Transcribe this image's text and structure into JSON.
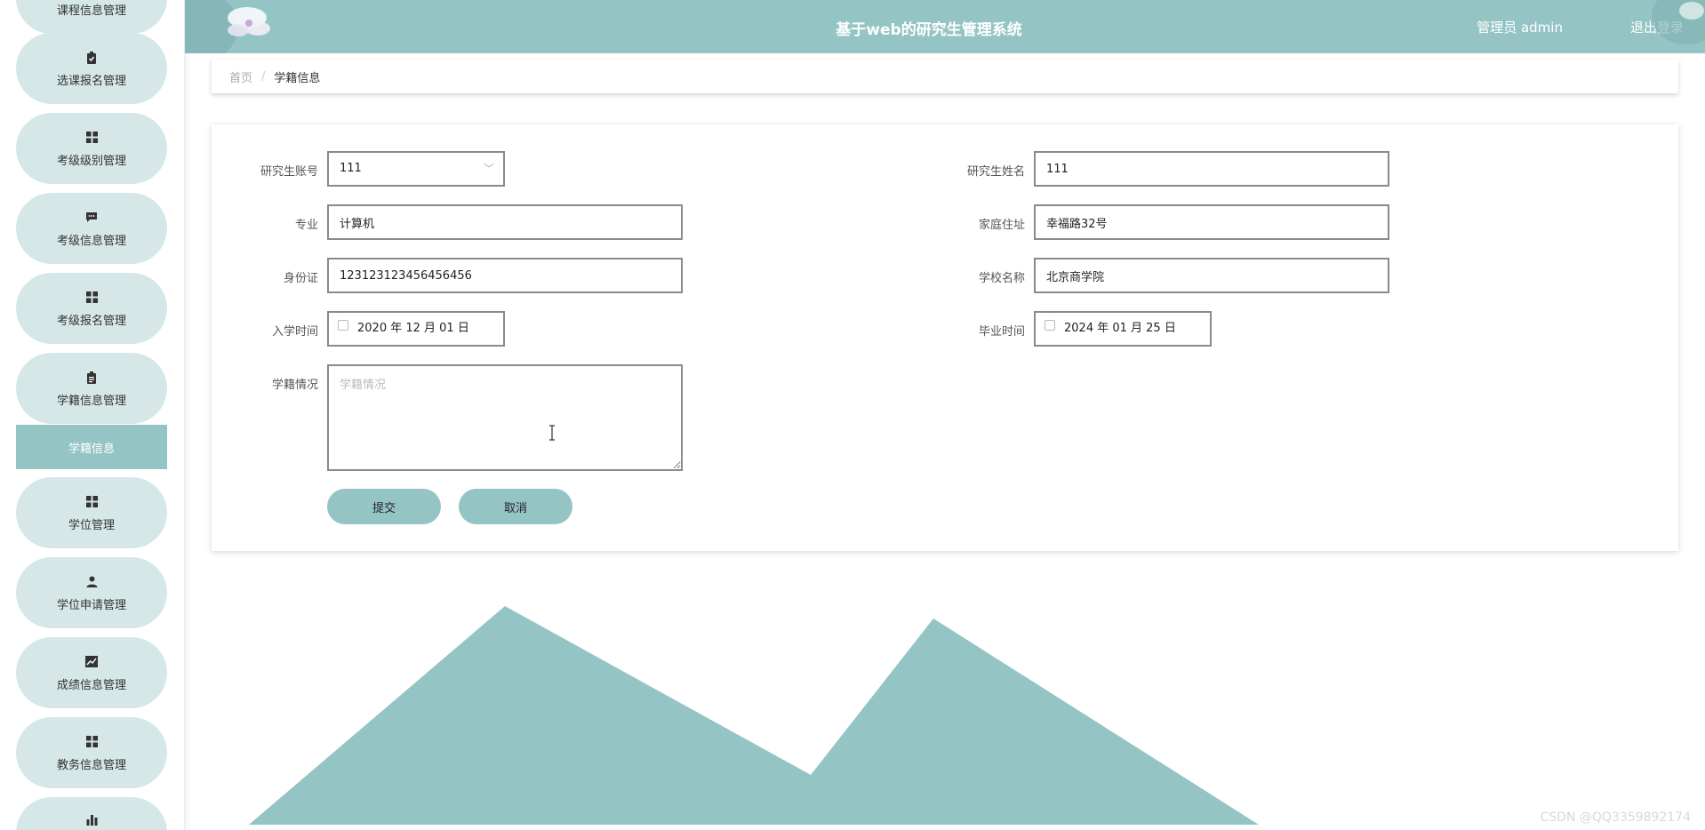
{
  "header": {
    "title": "基于web的研究生管理系统",
    "user": "管理员 admin",
    "logout": "退出登录"
  },
  "sidebar": {
    "items": [
      {
        "label": "课程信息管理",
        "icon": "clipboard-icon"
      },
      {
        "label": "选课报名管理",
        "icon": "clipboard-check-icon"
      },
      {
        "label": "考级级别管理",
        "icon": "grid-icon"
      },
      {
        "label": "考级信息管理",
        "icon": "message-icon"
      },
      {
        "label": "考级报名管理",
        "icon": "grid-icon"
      },
      {
        "label": "学籍信息管理",
        "icon": "clipboard-icon"
      },
      {
        "label": "学位管理",
        "icon": "grid-icon"
      },
      {
        "label": "学位申请管理",
        "icon": "user-icon"
      },
      {
        "label": "成绩信息管理",
        "icon": "chart-line-icon"
      },
      {
        "label": "教务信息管理",
        "icon": "grid-icon"
      },
      {
        "label": "",
        "icon": "bar-chart-icon"
      }
    ],
    "active_sub": "学籍信息"
  },
  "breadcrumb": {
    "home": "首页",
    "separator": "/",
    "current": "学籍信息"
  },
  "form": {
    "account": {
      "label": "研究生账号",
      "value": "111"
    },
    "name": {
      "label": "研究生姓名",
      "value": "111"
    },
    "major": {
      "label": "专业",
      "value": "计算机"
    },
    "address": {
      "label": "家庭住址",
      "value": "幸福路32号"
    },
    "id_card": {
      "label": "身份证",
      "value": "123123123456456456"
    },
    "school": {
      "label": "学校名称",
      "value": "北京商学院"
    },
    "enroll_date": {
      "label": "入学时间",
      "value": "2020 年 12 月 01 日"
    },
    "grad_date": {
      "label": "毕业时间",
      "value": "2024 年 01 月 25 日"
    },
    "status": {
      "label": "学籍情况",
      "placeholder": "学籍情况",
      "value": ""
    },
    "submit": "提交",
    "cancel": "取消"
  },
  "watermark": "CSDN @QQ3359892174",
  "colors": {
    "accent": "#95c4c5",
    "sidebar_item_bg": "#d6e7e7",
    "header_text": "#ffffff"
  }
}
